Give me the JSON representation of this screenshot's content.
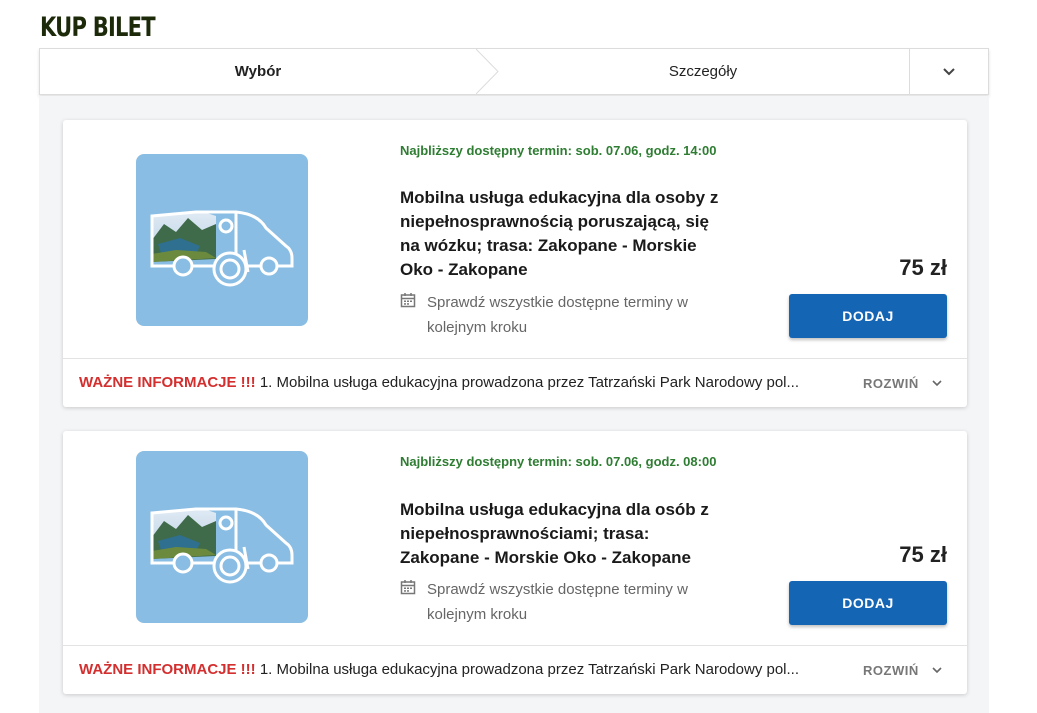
{
  "page": {
    "title": "KUP BILET"
  },
  "stepper": {
    "steps": [
      "Wybór",
      "Szczegóły"
    ],
    "toggle_icon": "chevron-down-icon"
  },
  "products": [
    {
      "next_date": "Najbliższy dostępny termin: sob. 07.06, godz. 14:00",
      "title": "Mobilna usługa edukacyjna dla osoby z niepełnosprawnością poruszającą, się na wózku; trasa: Zakopane - Morskie Oko - Zakopane",
      "terms_text": "Sprawdź wszystkie dostępne terminy w kolejnym kroku",
      "price": "75 zł",
      "add_label": "DODAJ",
      "info_label": "WAŻNE INFORMACJE !!!",
      "info_text": " 1. Mobilna usługa edukacyjna prowadzona przez Tatrzański Park Narodowy pol...",
      "expand_label": "ROZWIŃ"
    },
    {
      "next_date": "Najbliższy dostępny termin: sob. 07.06, godz. 08:00",
      "title": "Mobilna usługa edukacyjna dla osób z niepełnosprawnościami; trasa: Zakopane - Morskie Oko - Zakopane",
      "terms_text": "Sprawdź wszystkie dostępne terminy w kolejnym kroku",
      "price": "75 zł",
      "add_label": "DODAJ",
      "info_label": "WAŻNE INFORMACJE !!!",
      "info_text": " 1. Mobilna usługa edukacyjna prowadzona przez Tatrzański Park Narodowy pol...",
      "expand_label": "ROZWIŃ"
    }
  ],
  "colors": {
    "accent_button": "#1565b5",
    "date_green": "#2e7d32",
    "info_red": "#d32f2f",
    "thumb_bg": "#8abde3",
    "title_dark": "#1d2a0a"
  }
}
